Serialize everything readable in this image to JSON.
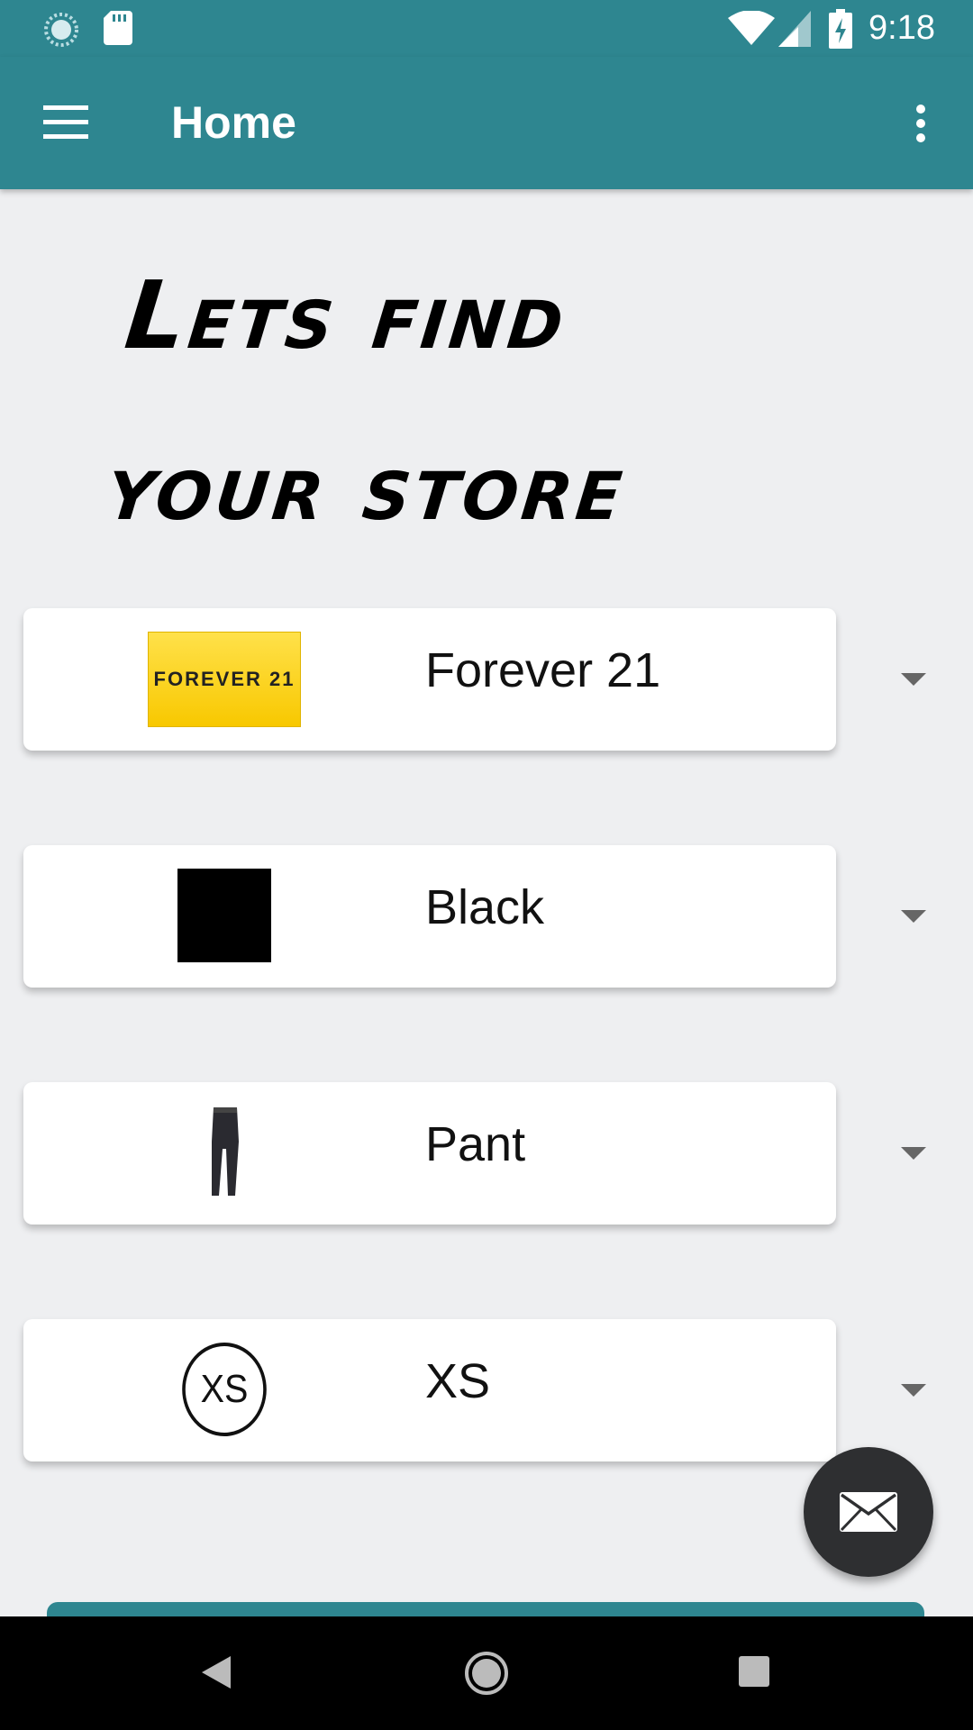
{
  "status_bar": {
    "time": "9:18",
    "icons": [
      "sync-icon",
      "sd-card-icon",
      "wifi-icon",
      "cellular-signal-icon",
      "battery-charging-icon"
    ]
  },
  "app_bar": {
    "title": "Home",
    "menu_icon": "hamburger-menu-icon",
    "overflow_icon": "more-vert-icon"
  },
  "headline": {
    "line1": "Lets find",
    "line2": "your store"
  },
  "filters": [
    {
      "label": "Forever 21",
      "image": "forever21-logo",
      "logo_text": "FOREVER 21"
    },
    {
      "label": "Black",
      "image": "black-color-swatch"
    },
    {
      "label": "Pant",
      "image": "pant-thumbnail"
    },
    {
      "label": "XS",
      "image": "xs-size-badge",
      "badge_text": "XS"
    }
  ],
  "fab": {
    "icon": "email-icon"
  },
  "nav_bar": {
    "icons": [
      "back-icon",
      "home-icon",
      "recents-icon"
    ]
  },
  "colors": {
    "primary": "#2e8690",
    "background": "#eeeff1",
    "fab": "#2e2f31"
  }
}
